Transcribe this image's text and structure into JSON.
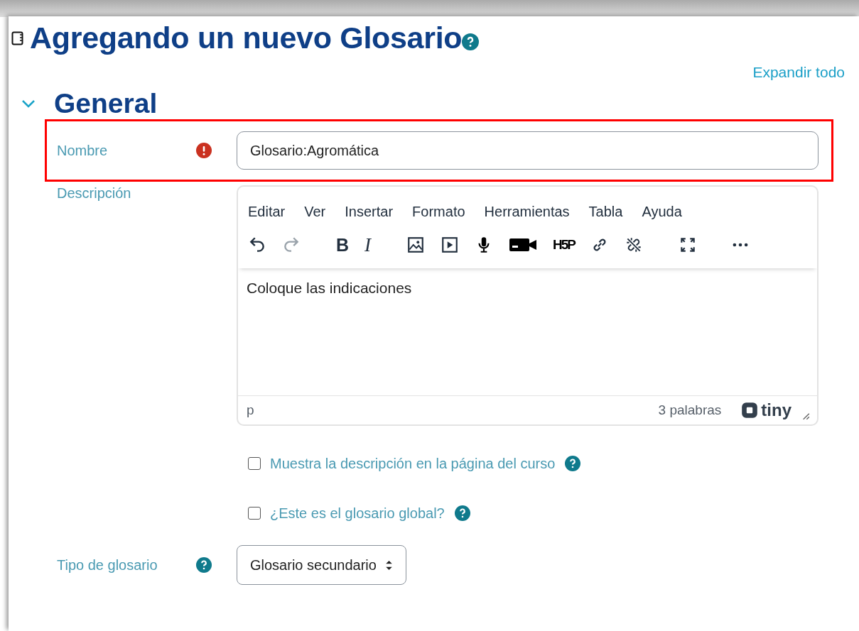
{
  "title": "Agregando un nuevo Glosario",
  "expand_all": "Expandir todo",
  "section": {
    "title": "General",
    "expanded": true
  },
  "name_field": {
    "label": "Nombre",
    "required": true,
    "highlighted": true,
    "value": "Glosario:Agromática"
  },
  "description": {
    "label": "Descripción",
    "menu": [
      "Editar",
      "Ver",
      "Insertar",
      "Formato",
      "Herramientas",
      "Tabla",
      "Ayuda"
    ],
    "toolbar": [
      {
        "kind": "undo",
        "disabled": false
      },
      {
        "kind": "redo",
        "disabled": true
      },
      {
        "kind": "bold",
        "label": "B",
        "disabled": false
      },
      {
        "kind": "italic",
        "label": "I",
        "disabled": false
      },
      {
        "kind": "image",
        "disabled": false
      },
      {
        "kind": "media",
        "disabled": false
      },
      {
        "kind": "audio",
        "disabled": false
      },
      {
        "kind": "video",
        "disabled": false
      },
      {
        "kind": "h5p",
        "label": "H5P",
        "disabled": false
      },
      {
        "kind": "link",
        "disabled": false
      },
      {
        "kind": "unlink",
        "disabled": false
      },
      {
        "kind": "fullscreen",
        "disabled": false
      },
      {
        "kind": "more",
        "disabled": false
      }
    ],
    "content": "Coloque las indicaciones",
    "path": "p",
    "word_count": "3 palabras",
    "brand": "tiny"
  },
  "checkboxes": [
    {
      "label": "Muestra la descripción en la página del curso",
      "checked": false
    },
    {
      "label": "¿Este es el glosario global?",
      "checked": false
    }
  ],
  "type_field": {
    "label": "Tipo de glosario",
    "value": "Glosario secundario"
  }
}
